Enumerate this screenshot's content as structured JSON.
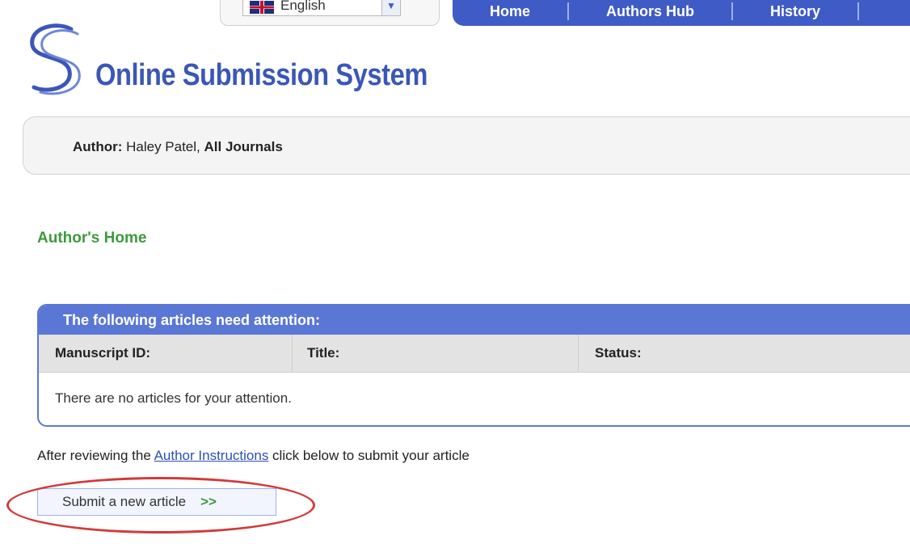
{
  "language": {
    "selected": "English",
    "flag_icon": "uk-flag-icon"
  },
  "nav": {
    "items": [
      "Home",
      "Authors Hub",
      "History",
      ""
    ]
  },
  "logo": {
    "title": "Online Submission System"
  },
  "author_bar": {
    "role_label": "Author:",
    "name": "Haley Patel,",
    "scope": "All Journals"
  },
  "page": {
    "heading": "Author's Home"
  },
  "attention_panel": {
    "header": "The following articles need attention:",
    "columns": [
      "Manuscript ID:",
      "Title:",
      "Status:"
    ],
    "empty_message": "There are no articles for your attention."
  },
  "instructions": {
    "before_link": "After reviewing the ",
    "link_text": "Author Instructions",
    "after_link": " click below to submit your article"
  },
  "submit": {
    "label": "Submit a new article",
    "arrows": ">>"
  },
  "colors": {
    "brand_blue": "#3f5bc5",
    "panel_blue": "#5b77d6",
    "heading_green": "#3d9a3d",
    "highlight_red": "#d23a3a"
  }
}
